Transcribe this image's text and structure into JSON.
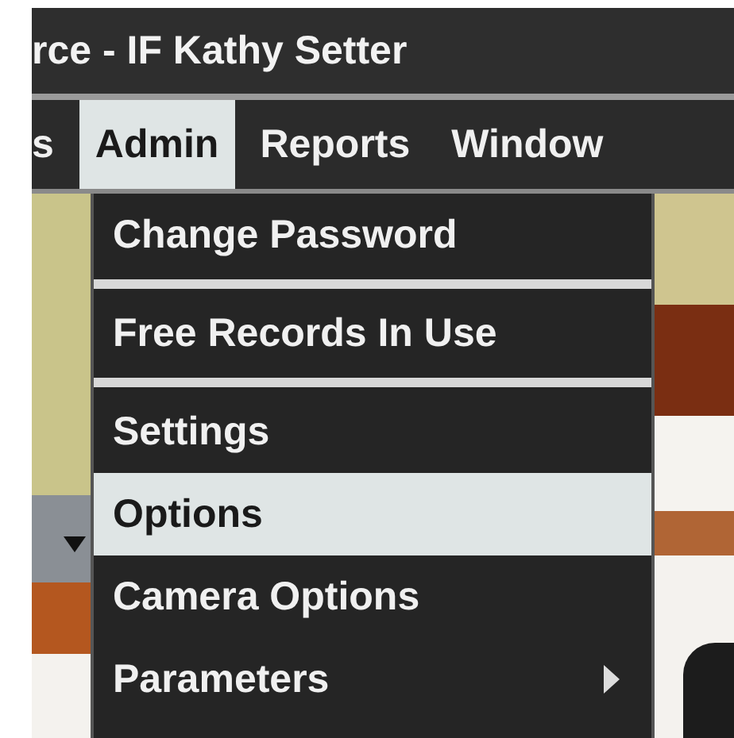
{
  "window": {
    "title": "rce - IF Kathy Setter"
  },
  "menu_bar": [
    {
      "label": "s",
      "selected": false
    },
    {
      "label": "Admin",
      "selected": true
    },
    {
      "label": "Reports",
      "selected": false
    },
    {
      "label": "Window",
      "selected": false
    }
  ],
  "dropdown": [
    {
      "label": "Change Password",
      "selected": false,
      "submenu": false,
      "separator_after": true
    },
    {
      "label": "Free Records In Use",
      "selected": false,
      "submenu": false,
      "separator_after": true
    },
    {
      "label": "Settings",
      "selected": false,
      "submenu": false,
      "separator_after": false
    },
    {
      "label": "Options",
      "selected": true,
      "submenu": false,
      "separator_after": false
    },
    {
      "label": "Camera Options",
      "selected": false,
      "submenu": false,
      "separator_after": false
    },
    {
      "label": "Parameters",
      "selected": false,
      "submenu": true,
      "separator_after": false
    }
  ]
}
